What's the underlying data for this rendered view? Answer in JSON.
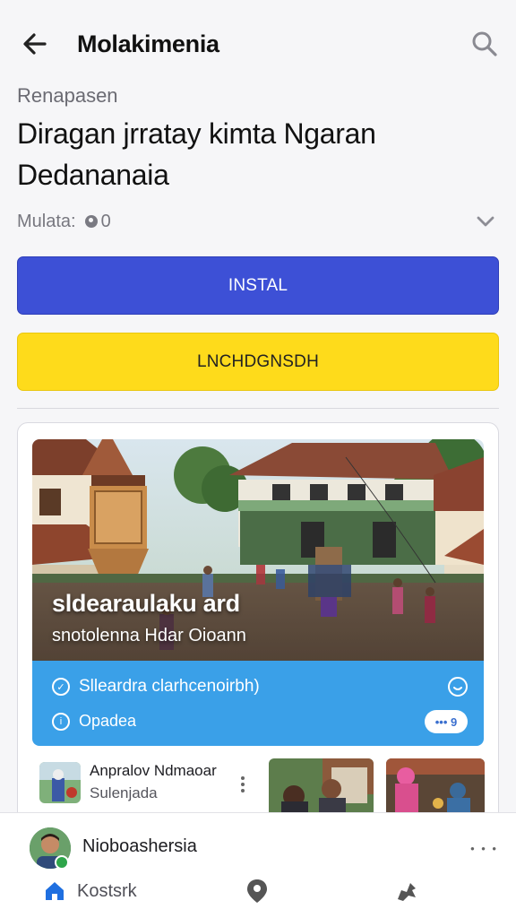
{
  "header": {
    "title": "Molakimenia",
    "back_icon": "arrow-left-icon",
    "search_icon": "search-icon"
  },
  "listing": {
    "eyebrow": "Renapasen",
    "headline": "Diragan jrratay kimta Ngaran Dedananaia",
    "meta_label": "Mulata:",
    "meta_value": "0",
    "meta_icon": "rating-icon",
    "expand_icon": "chevron-down-icon"
  },
  "actions": {
    "install_label": "INSTAL",
    "secondary_label": "LNCHDGNSDH",
    "install_color": "#3d50d6",
    "secondary_color": "#fedb1b"
  },
  "card": {
    "hero_title": "sldearaulaku ard",
    "hero_subtitle": "snotolenna Hdar Oioann",
    "panel_color": "#3aa0e8",
    "panel_line1": "Slleardra clarhcenoirbh)",
    "panel_line2": "Opadea",
    "panel_pill": "••• 9",
    "panel_line1_icon": "check-circle-icon",
    "panel_line2_icon": "info-circle-icon",
    "panel_bell_icon": "bell-icon",
    "list_item": {
      "title": "Anpralov Ndmaoar",
      "subtitle": "Sulenjada",
      "more_icon": "more-vertical-icon"
    }
  },
  "bottom_sheet": {
    "name": "Nioboashersia",
    "more": "• • •",
    "nav": {
      "home_label": "Kostsrk",
      "home_icon": "home-icon",
      "middle_icon": "location-pin-icon",
      "right_icon": "share-icon"
    }
  }
}
